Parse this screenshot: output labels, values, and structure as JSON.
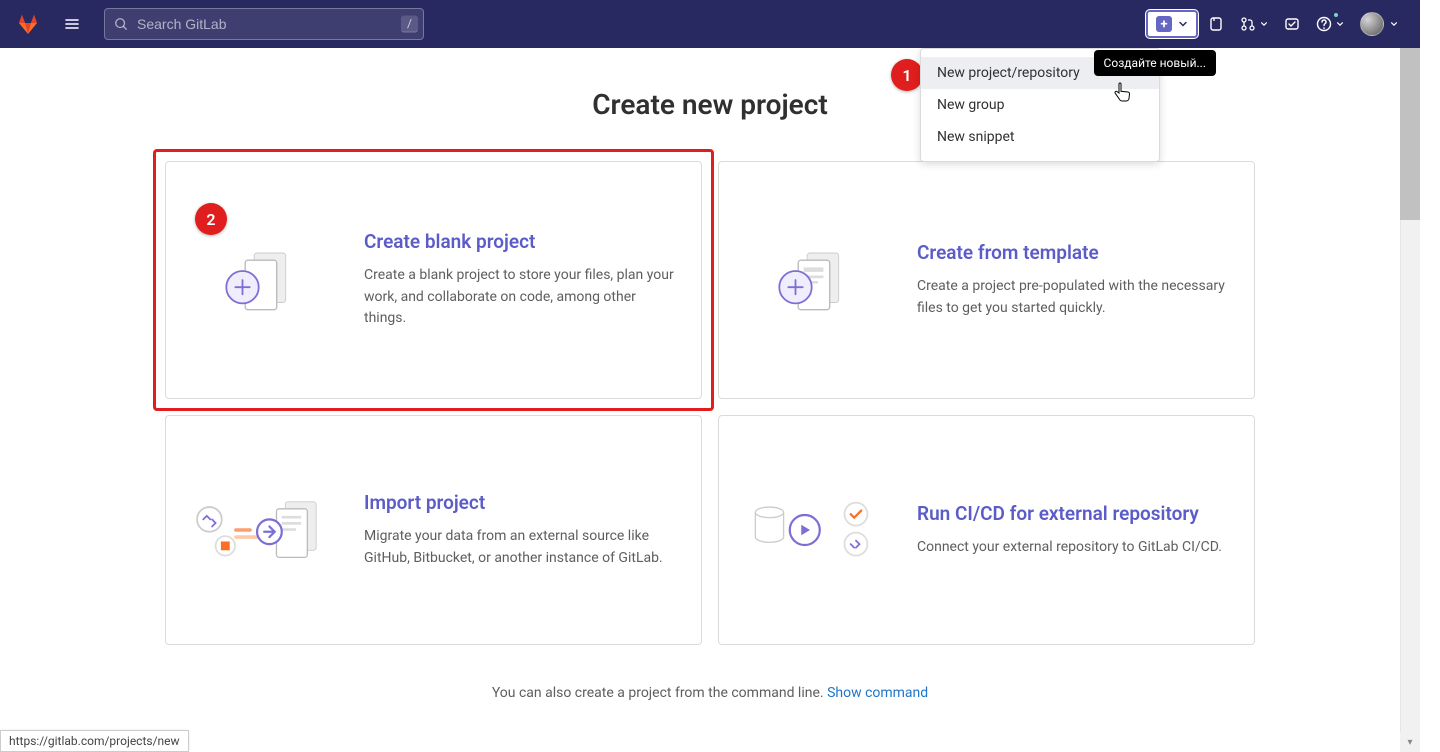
{
  "header": {
    "search_placeholder": "Search GitLab",
    "search_kbd": "/"
  },
  "dropdown": {
    "items": [
      "New project/repository",
      "New group",
      "New snippet"
    ],
    "tooltip": "Создайте новый..."
  },
  "page": {
    "title": "Create new project",
    "footer_text": "You can also create a project from the command line. ",
    "footer_link": "Show command",
    "status_url": "https://gitlab.com/projects/new"
  },
  "cards": [
    {
      "title": "Create blank project",
      "desc": "Create a blank project to store your files, plan your work, and collaborate on code, among other things."
    },
    {
      "title": "Create from template",
      "desc": "Create a project pre-populated with the necessary files to get you started quickly."
    },
    {
      "title": "Import project",
      "desc": "Migrate your data from an external source like GitHub, Bitbucket, or another instance of GitLab."
    },
    {
      "title": "Run CI/CD for external repository",
      "desc": "Connect your external repository to GitLab CI/CD."
    }
  ],
  "badges": {
    "one": "1",
    "two": "2"
  },
  "colors": {
    "primary": "#292961",
    "accent": "#5c5cc9",
    "danger": "#e01e1e",
    "link": "#1f75cb"
  }
}
